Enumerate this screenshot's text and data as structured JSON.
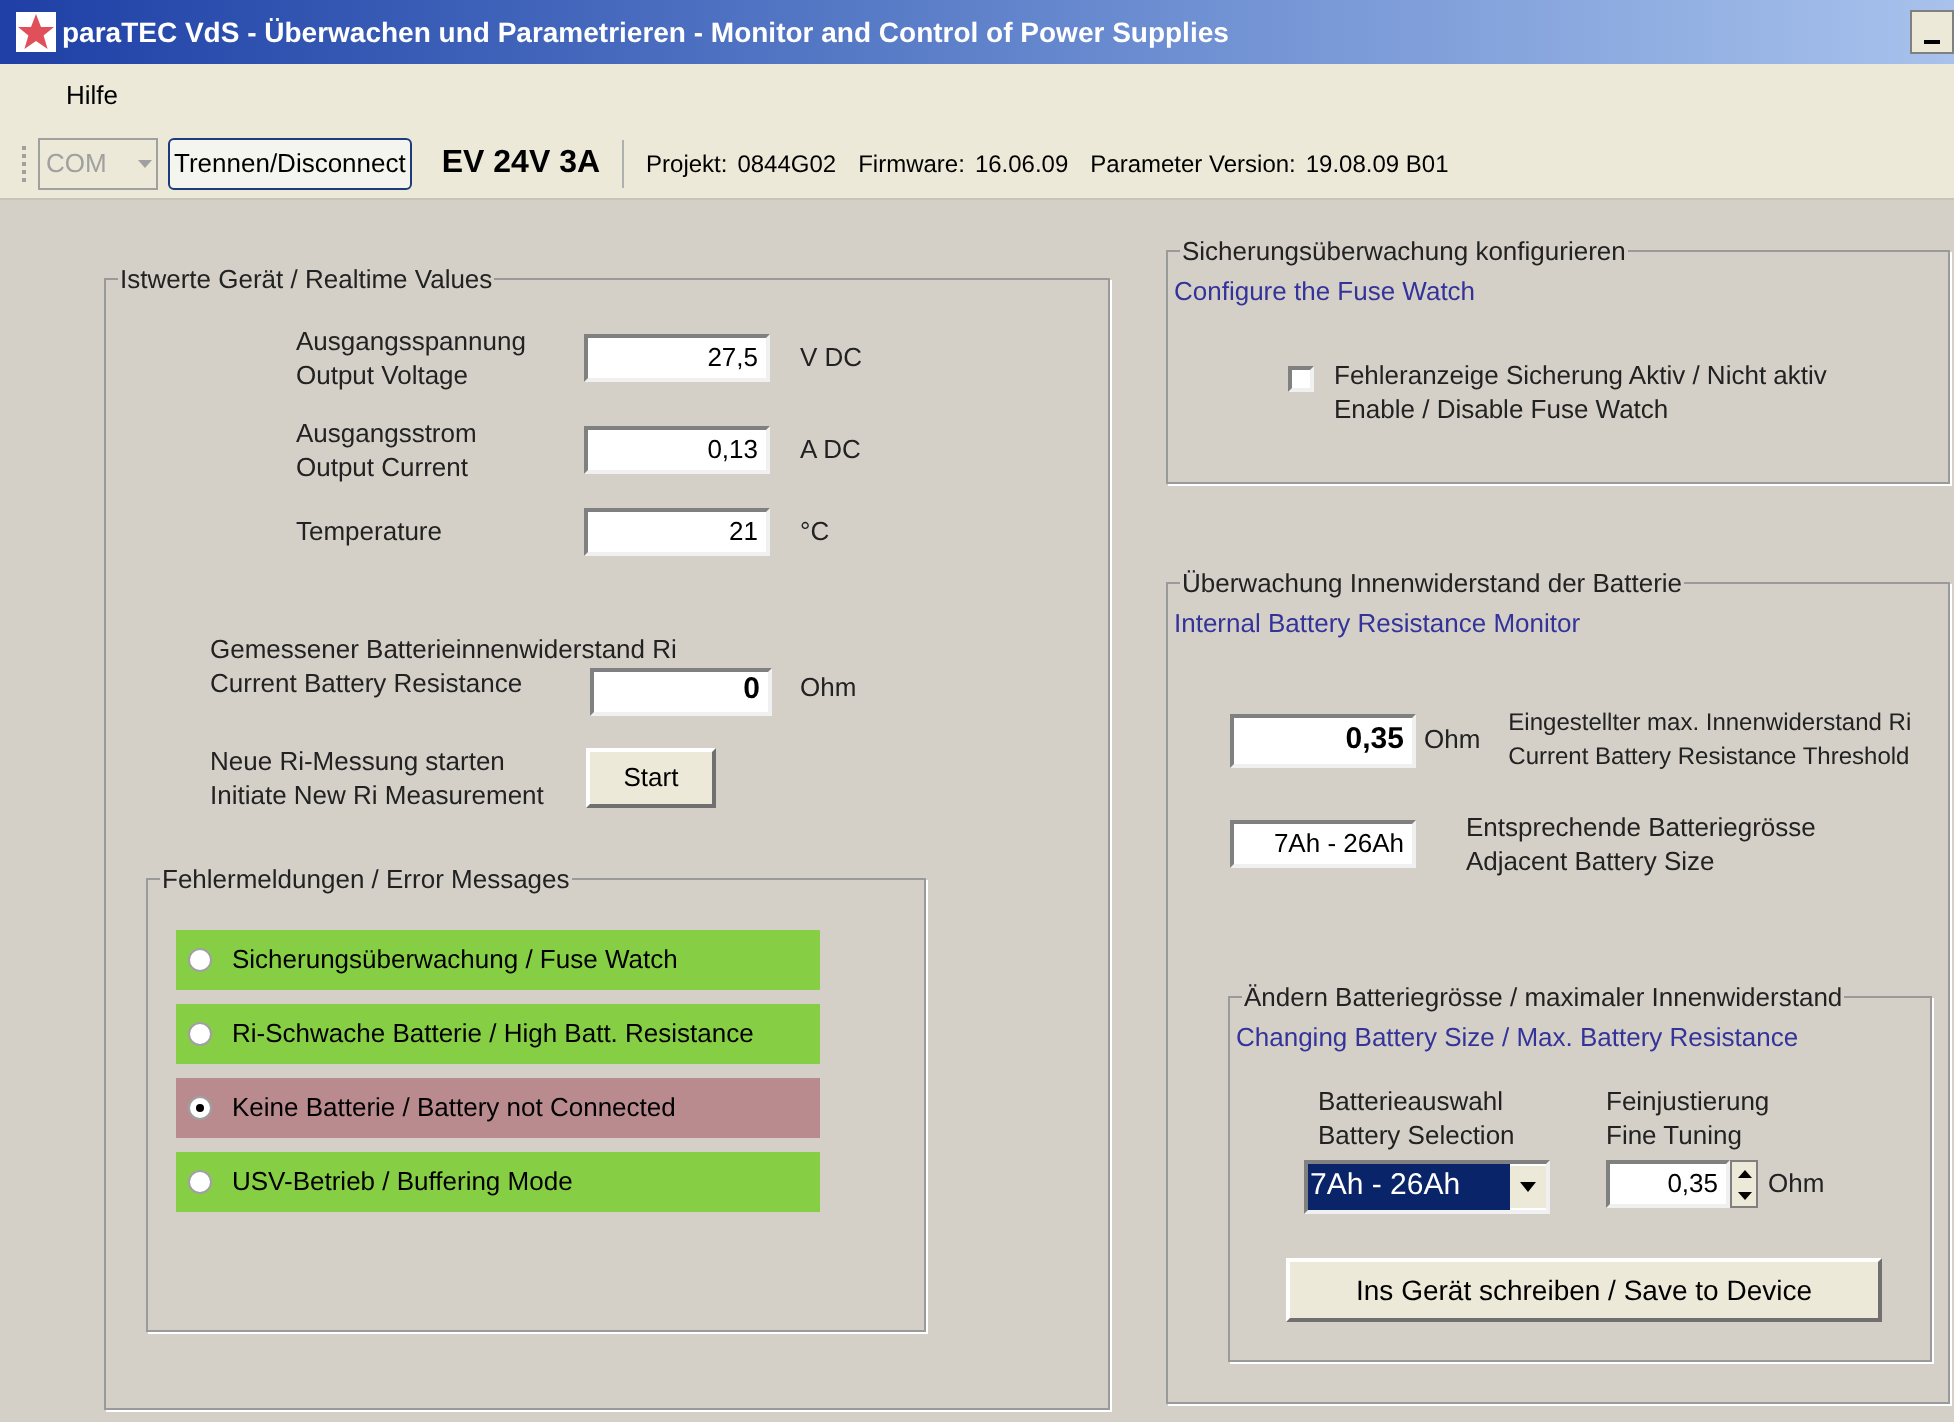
{
  "window": {
    "title": "paraTEC VdS - Überwachen und Parametrieren  - Monitor and Control of Power Supplies"
  },
  "menu": [
    "Hilfe"
  ],
  "toolbar": {
    "port": {
      "value": "COM",
      "disabled": true
    },
    "disconnect_button": "Trennen/Disconnect",
    "device": "EV 24V 3A",
    "info": [
      {
        "label": "Projekt:",
        "value": "0844G02"
      },
      {
        "label": "Firmware:",
        "value": "16.06.09"
      },
      {
        "label": "Parameter Version:",
        "value": "19.08.09 B01"
      }
    ]
  },
  "realtime": {
    "title": "Istwerte Gerät / Realtime Values",
    "values": [
      {
        "label": [
          "Ausgangsspannung",
          "Output Voltage"
        ],
        "value": "27,5",
        "unit": "V DC"
      },
      {
        "label": [
          "Ausgangsstrom",
          "Output Current"
        ],
        "value": "0,13",
        "unit": "A DC"
      },
      {
        "label": [
          "Temperature"
        ],
        "value": "21",
        "unit": "°C"
      }
    ],
    "resistance": {
      "label": [
        "Gemessener Batterieinnenwiderstand Ri",
        "Current Battery Resistance"
      ],
      "value": "0",
      "unit": "Ohm"
    },
    "measurement": {
      "label": [
        "Neue Ri-Messung starten",
        "Initiate New Ri Measurement"
      ],
      "button": "Start"
    }
  },
  "errors": {
    "title": "Fehlermeldungen / Error Messages",
    "items": [
      {
        "label": "Sicherungsüberwachung / Fuse Watch",
        "selected": false,
        "color": "#86cf45"
      },
      {
        "label": "Ri-Schwache Batterie / High Batt. Resistance",
        "selected": false,
        "color": "#86cf45"
      },
      {
        "label": "Keine Batterie / Battery not Connected",
        "selected": true,
        "color": "#b98a8e"
      },
      {
        "label": "USV-Betrieb / Buffering Mode",
        "selected": false,
        "color": "#86cf45"
      }
    ]
  },
  "fuse_watch": {
    "title": "Sicherungsüberwachung konfigurieren",
    "subtitle": "Configure the Fuse Watch",
    "checkbox": {
      "label": [
        "Fehleranzeige Sicherung Aktiv / Nicht aktiv",
        "Enable / Disable Fuse Watch"
      ],
      "checked": false
    }
  },
  "battery_monitor": {
    "title": "Überwachung Innenwiderstand der Batterie",
    "subtitle": "Internal Battery Resistance Monitor",
    "threshold": {
      "value": "0,35",
      "unit": "Ohm",
      "label": [
        "Eingestellter max. Innenwiderstand Ri",
        "Current Battery Resistance Threshold"
      ]
    },
    "size": {
      "value": "7Ah - 26Ah",
      "label": [
        "Entsprechende Batteriegrösse",
        "Adjacent Battery Size"
      ]
    },
    "change": {
      "title": "Ändern Batteriegrösse / maximaler Innenwiderstand",
      "subtitle": "Changing Battery Size / Max. Battery Resistance",
      "selection": {
        "label": [
          "Batterieauswahl",
          "Battery Selection"
        ],
        "value": "7Ah - 26Ah"
      },
      "fine_tuning": {
        "label": [
          "Feinjustierung",
          "Fine Tuning"
        ],
        "value": "0,35",
        "unit": "Ohm"
      },
      "save_button": "Ins Gerät schreiben / Save to Device"
    }
  }
}
